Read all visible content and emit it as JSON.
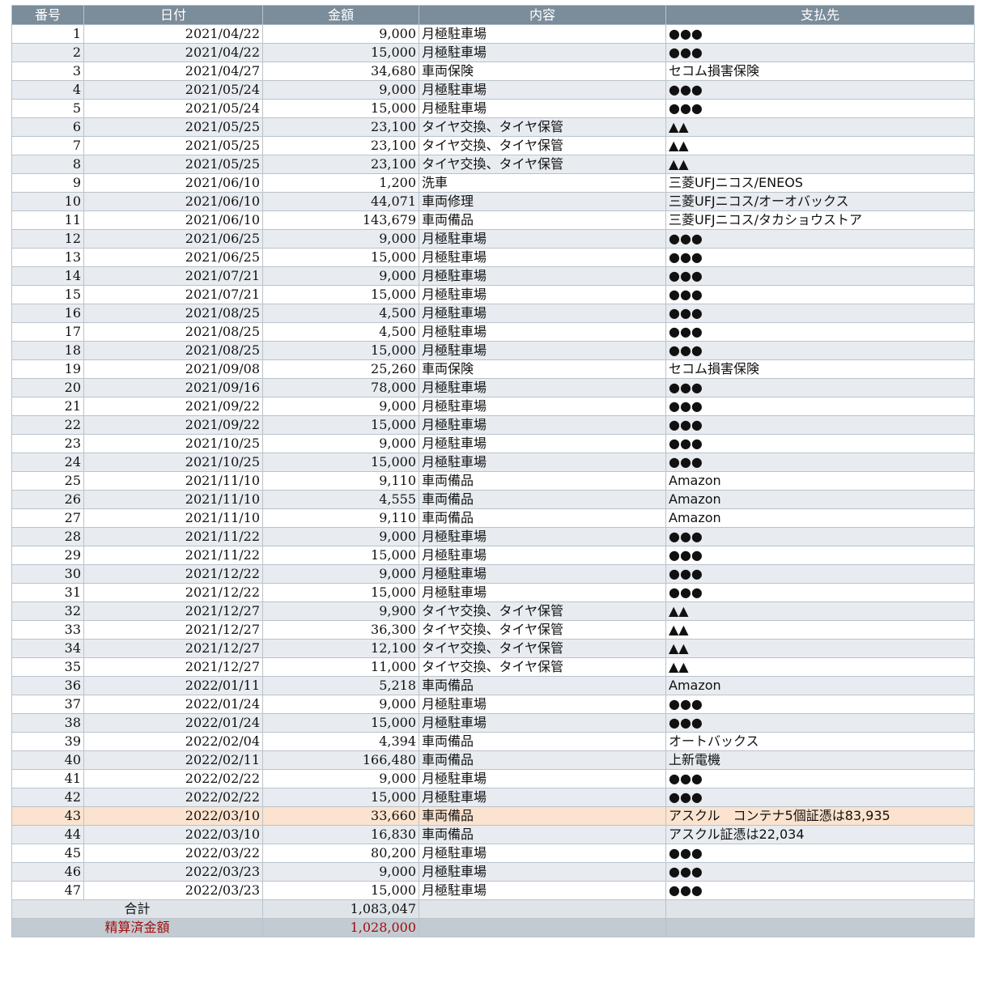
{
  "headers": {
    "number": "番号",
    "date": "日付",
    "amount": "金額",
    "description": "内容",
    "payee": "支払先"
  },
  "rows": [
    {
      "no": "1",
      "date": "2021/04/22",
      "amount": "9,000",
      "desc": "月極駐車場",
      "payee": "●●●"
    },
    {
      "no": "2",
      "date": "2021/04/22",
      "amount": "15,000",
      "desc": "月極駐車場",
      "payee": "●●●"
    },
    {
      "no": "3",
      "date": "2021/04/27",
      "amount": "34,680",
      "desc": "車両保険",
      "payee": "セコム損害保険"
    },
    {
      "no": "4",
      "date": "2021/05/24",
      "amount": "9,000",
      "desc": "月極駐車場",
      "payee": "●●●"
    },
    {
      "no": "5",
      "date": "2021/05/24",
      "amount": "15,000",
      "desc": "月極駐車場",
      "payee": "●●●"
    },
    {
      "no": "6",
      "date": "2021/05/25",
      "amount": "23,100",
      "desc": "タイヤ交換、タイヤ保管",
      "payee": "▲▲"
    },
    {
      "no": "7",
      "date": "2021/05/25",
      "amount": "23,100",
      "desc": "タイヤ交換、タイヤ保管",
      "payee": "▲▲"
    },
    {
      "no": "8",
      "date": "2021/05/25",
      "amount": "23,100",
      "desc": "タイヤ交換、タイヤ保管",
      "payee": "▲▲"
    },
    {
      "no": "9",
      "date": "2021/06/10",
      "amount": "1,200",
      "desc": "洗車",
      "payee": "三菱UFJニコス/ENEOS"
    },
    {
      "no": "10",
      "date": "2021/06/10",
      "amount": "44,071",
      "desc": "車両修理",
      "payee": "三菱UFJニコス/オーオバックス"
    },
    {
      "no": "11",
      "date": "2021/06/10",
      "amount": "143,679",
      "desc": "車両備品",
      "payee": "三菱UFJニコス/タカショウストア"
    },
    {
      "no": "12",
      "date": "2021/06/25",
      "amount": "9,000",
      "desc": "月極駐車場",
      "payee": "●●●"
    },
    {
      "no": "13",
      "date": "2021/06/25",
      "amount": "15,000",
      "desc": "月極駐車場",
      "payee": "●●●"
    },
    {
      "no": "14",
      "date": "2021/07/21",
      "amount": "9,000",
      "desc": "月極駐車場",
      "payee": "●●●"
    },
    {
      "no": "15",
      "date": "2021/07/21",
      "amount": "15,000",
      "desc": "月極駐車場",
      "payee": "●●●"
    },
    {
      "no": "16",
      "date": "2021/08/25",
      "amount": "4,500",
      "desc": "月極駐車場",
      "payee": "●●●"
    },
    {
      "no": "17",
      "date": "2021/08/25",
      "amount": "4,500",
      "desc": "月極駐車場",
      "payee": "●●●"
    },
    {
      "no": "18",
      "date": "2021/08/25",
      "amount": "15,000",
      "desc": "月極駐車場",
      "payee": "●●●"
    },
    {
      "no": "19",
      "date": "2021/09/08",
      "amount": "25,260",
      "desc": "車両保険",
      "payee": "セコム損害保険"
    },
    {
      "no": "20",
      "date": "2021/09/16",
      "amount": "78,000",
      "desc": "月極駐車場",
      "payee": "●●●"
    },
    {
      "no": "21",
      "date": "2021/09/22",
      "amount": "9,000",
      "desc": "月極駐車場",
      "payee": "●●●"
    },
    {
      "no": "22",
      "date": "2021/09/22",
      "amount": "15,000",
      "desc": "月極駐車場",
      "payee": "●●●"
    },
    {
      "no": "23",
      "date": "2021/10/25",
      "amount": "9,000",
      "desc": "月極駐車場",
      "payee": "●●●"
    },
    {
      "no": "24",
      "date": "2021/10/25",
      "amount": "15,000",
      "desc": "月極駐車場",
      "payee": "●●●"
    },
    {
      "no": "25",
      "date": "2021/11/10",
      "amount": "9,110",
      "desc": "車両備品",
      "payee": "Amazon"
    },
    {
      "no": "26",
      "date": "2021/11/10",
      "amount": "4,555",
      "desc": "車両備品",
      "payee": "Amazon"
    },
    {
      "no": "27",
      "date": "2021/11/10",
      "amount": "9,110",
      "desc": "車両備品",
      "payee": "Amazon"
    },
    {
      "no": "28",
      "date": "2021/11/22",
      "amount": "9,000",
      "desc": "月極駐車場",
      "payee": "●●●"
    },
    {
      "no": "29",
      "date": "2021/11/22",
      "amount": "15,000",
      "desc": "月極駐車場",
      "payee": "●●●"
    },
    {
      "no": "30",
      "date": "2021/12/22",
      "amount": "9,000",
      "desc": "月極駐車場",
      "payee": "●●●"
    },
    {
      "no": "31",
      "date": "2021/12/22",
      "amount": "15,000",
      "desc": "月極駐車場",
      "payee": "●●●"
    },
    {
      "no": "32",
      "date": "2021/12/27",
      "amount": "9,900",
      "desc": "タイヤ交換、タイヤ保管",
      "payee": "▲▲"
    },
    {
      "no": "33",
      "date": "2021/12/27",
      "amount": "36,300",
      "desc": "タイヤ交換、タイヤ保管",
      "payee": "▲▲"
    },
    {
      "no": "34",
      "date": "2021/12/27",
      "amount": "12,100",
      "desc": "タイヤ交換、タイヤ保管",
      "payee": "▲▲"
    },
    {
      "no": "35",
      "date": "2021/12/27",
      "amount": "11,000",
      "desc": "タイヤ交換、タイヤ保管",
      "payee": "▲▲"
    },
    {
      "no": "36",
      "date": "2022/01/11",
      "amount": "5,218",
      "desc": "車両備品",
      "payee": "Amazon"
    },
    {
      "no": "37",
      "date": "2022/01/24",
      "amount": "9,000",
      "desc": "月極駐車場",
      "payee": "●●●"
    },
    {
      "no": "38",
      "date": "2022/01/24",
      "amount": "15,000",
      "desc": "月極駐車場",
      "payee": "●●●"
    },
    {
      "no": "39",
      "date": "2022/02/04",
      "amount": "4,394",
      "desc": "車両備品",
      "payee": "オートバックス"
    },
    {
      "no": "40",
      "date": "2022/02/11",
      "amount": "166,480",
      "desc": "車両備品",
      "payee": "上新電機"
    },
    {
      "no": "41",
      "date": "2022/02/22",
      "amount": "9,000",
      "desc": "月極駐車場",
      "payee": "●●●"
    },
    {
      "no": "42",
      "date": "2022/02/22",
      "amount": "15,000",
      "desc": "月極駐車場",
      "payee": "●●●"
    },
    {
      "no": "43",
      "date": "2022/03/10",
      "amount": "33,660",
      "desc": "車両備品",
      "payee": "アスクル　コンテナ5個証憑は83,935",
      "highlight": true
    },
    {
      "no": "44",
      "date": "2022/03/10",
      "amount": "16,830",
      "desc": "車両備品",
      "payee": "アスクル証憑は22,034"
    },
    {
      "no": "45",
      "date": "2022/03/22",
      "amount": "80,200",
      "desc": "月極駐車場",
      "payee": "●●●"
    },
    {
      "no": "46",
      "date": "2022/03/23",
      "amount": "9,000",
      "desc": "月極駐車場",
      "payee": "●●●"
    },
    {
      "no": "47",
      "date": "2022/03/23",
      "amount": "15,000",
      "desc": "月極駐車場",
      "payee": "●●●"
    }
  ],
  "footer": {
    "total_label": "合計",
    "total_amount": "1,083,047",
    "settled_label": "精算済金額",
    "settled_amount": "1,028,000"
  },
  "colors": {
    "header_bg": "#7b8c9a",
    "stripe": "#e8ecf0",
    "highlight": "#fbe3cf",
    "settled_text": "#a10d0d"
  }
}
